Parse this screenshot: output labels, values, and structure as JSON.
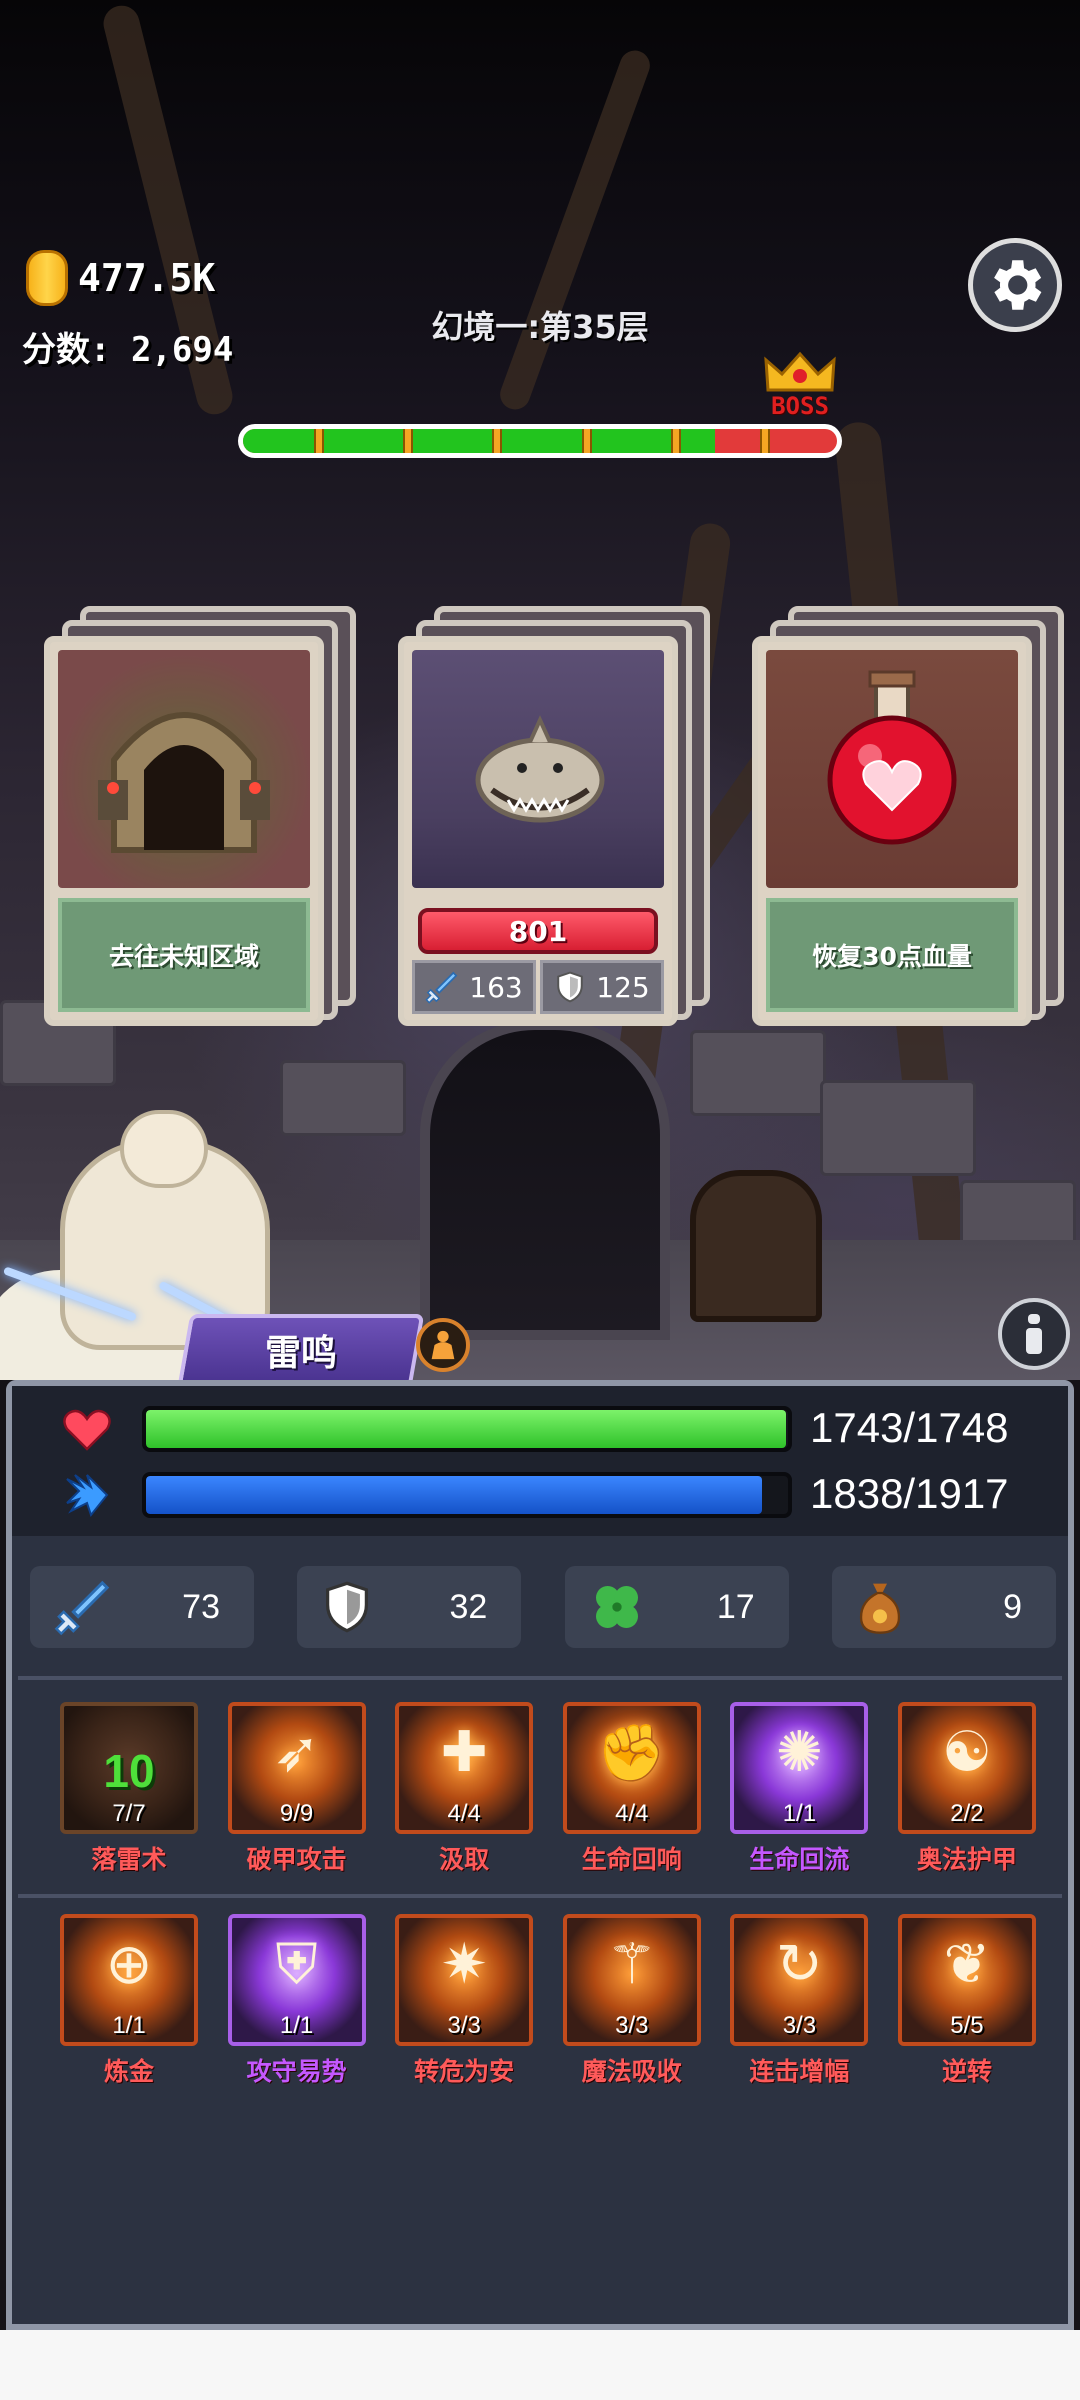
{
  "hud": {
    "coins": "477.5K",
    "score": "分数: 2,694",
    "level_title": "幻境一:第35层",
    "boss_label": "BOSS",
    "progress_segments": 7,
    "progress_green_fraction": 0.795
  },
  "cards": [
    {
      "label": "去往未知区域",
      "icon": "dungeon-door-icon"
    },
    {
      "enemy_hp": "801",
      "attack": "163",
      "defense": "125",
      "icon": "shark-monster-icon"
    },
    {
      "label": "恢复30点血量",
      "icon": "heart-potion-icon"
    }
  ],
  "hero": {
    "name": "雷鸣",
    "hp_text": "1743/1748",
    "hp_fraction": 0.997,
    "mp_text": "1838/1917",
    "mp_fraction": 0.959
  },
  "stats": [
    {
      "icon": "sword-icon",
      "value": "73"
    },
    {
      "icon": "shield-icon",
      "value": "32"
    },
    {
      "icon": "clover-icon",
      "value": "17"
    },
    {
      "icon": "money-bag-icon",
      "value": "9"
    }
  ],
  "skills_row1": [
    {
      "name": "落雷术",
      "level": "7/7",
      "badge": "10",
      "style": "dark"
    },
    {
      "name": "破甲攻击",
      "level": "9/9",
      "style": "orange"
    },
    {
      "name": "汲取",
      "level": "4/4",
      "style": "orange"
    },
    {
      "name": "生命回响",
      "level": "4/4",
      "style": "orange"
    },
    {
      "name": "生命回流",
      "level": "1/1",
      "style": "purple"
    },
    {
      "name": "奥法护甲",
      "level": "2/2",
      "style": "orange"
    }
  ],
  "skills_row2": [
    {
      "name": "炼金",
      "level": "1/1",
      "style": "orange"
    },
    {
      "name": "攻守易势",
      "level": "1/1",
      "style": "purple"
    },
    {
      "name": "转危为安",
      "level": "3/3",
      "style": "orange"
    },
    {
      "name": "魔法吸收",
      "level": "3/3",
      "style": "orange"
    },
    {
      "name": "连击增幅",
      "level": "3/3",
      "style": "orange"
    },
    {
      "name": "逆转",
      "level": "5/5",
      "style": "orange"
    }
  ],
  "colors": {
    "hp_bar": "#3fd43a",
    "mp_bar": "#1a63e0",
    "skill_name_orange": "#ff5a5a",
    "skill_name_purple": "#c458ff"
  }
}
